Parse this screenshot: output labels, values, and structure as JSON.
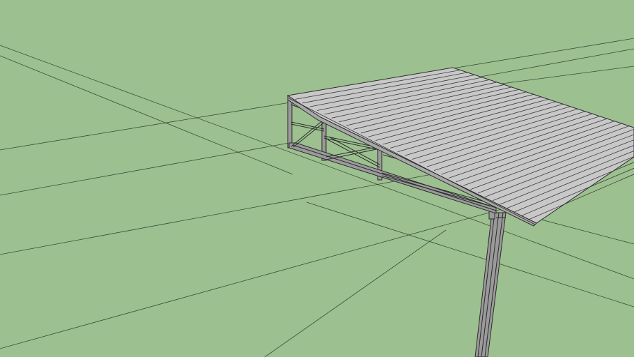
{
  "viewport": {
    "background_color": "#9cc08f",
    "line_color": "#2b2b2b",
    "roof_fill": "#c8c8c8",
    "steel_fill": "#9a9a9a"
  },
  "model": {
    "content": "steel-cantilever-canopy",
    "components": [
      "corrugated-roof-sheet",
      "roof-truss",
      "support-column",
      "ground-plane-guides"
    ]
  }
}
